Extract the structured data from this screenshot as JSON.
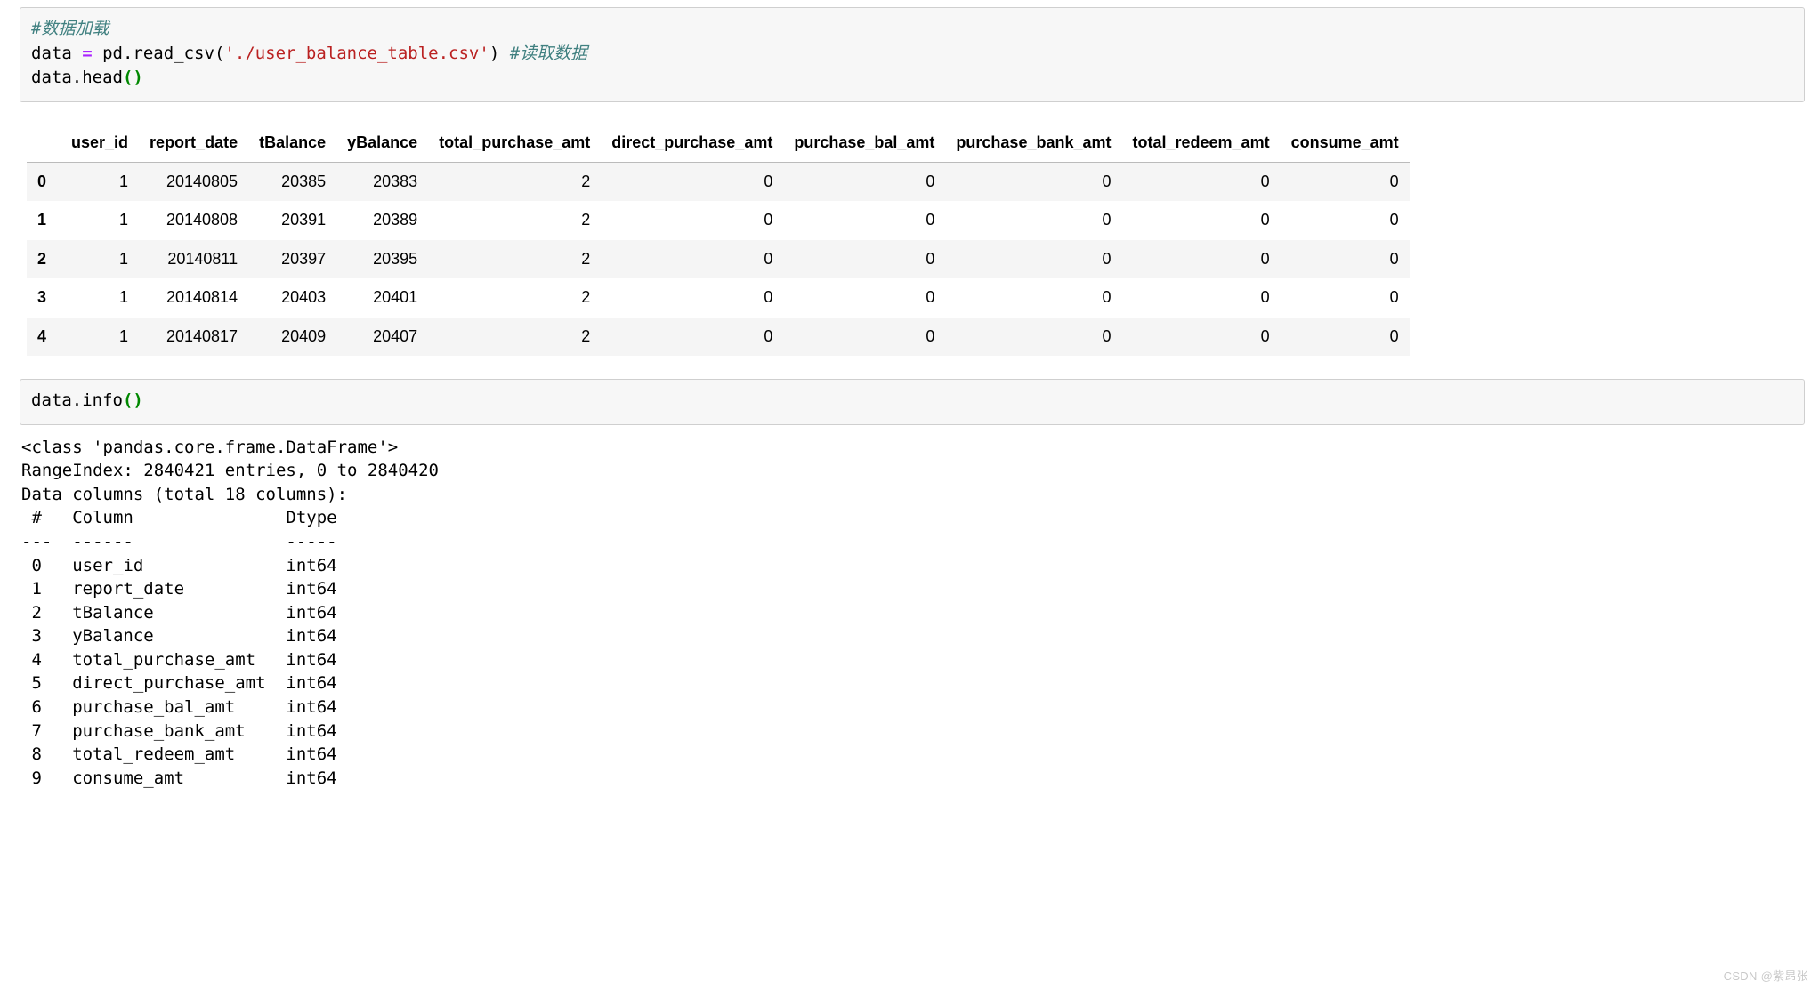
{
  "code_cell_1": {
    "line1_comment": "#数据加载",
    "line2_pre": "data ",
    "line2_op": "=",
    "line2_call": " pd.read_csv",
    "line2_str": "'./user_balance_table.csv'",
    "line2_comment": " #读取数据",
    "line3": "data.head"
  },
  "dataframe": {
    "columns": [
      "",
      "user_id",
      "report_date",
      "tBalance",
      "yBalance",
      "total_purchase_amt",
      "direct_purchase_amt",
      "purchase_bal_amt",
      "purchase_bank_amt",
      "total_redeem_amt",
      "consume_amt"
    ],
    "rows": [
      {
        "idx": "0",
        "vals": [
          "1",
          "20140805",
          "20385",
          "20383",
          "2",
          "0",
          "0",
          "0",
          "0",
          "0"
        ]
      },
      {
        "idx": "1",
        "vals": [
          "1",
          "20140808",
          "20391",
          "20389",
          "2",
          "0",
          "0",
          "0",
          "0",
          "0"
        ]
      },
      {
        "idx": "2",
        "vals": [
          "1",
          "20140811",
          "20397",
          "20395",
          "2",
          "0",
          "0",
          "0",
          "0",
          "0"
        ]
      },
      {
        "idx": "3",
        "vals": [
          "1",
          "20140814",
          "20403",
          "20401",
          "2",
          "0",
          "0",
          "0",
          "0",
          "0"
        ]
      },
      {
        "idx": "4",
        "vals": [
          "1",
          "20140817",
          "20409",
          "20407",
          "2",
          "0",
          "0",
          "0",
          "0",
          "0"
        ]
      }
    ]
  },
  "code_cell_2": {
    "line1": "data.info"
  },
  "info_output": {
    "lines": [
      "<class 'pandas.core.frame.DataFrame'>",
      "RangeIndex: 2840421 entries, 0 to 2840420",
      "Data columns (total 18 columns):",
      " #   Column               Dtype",
      "---  ------               -----",
      " 0   user_id              int64",
      " 1   report_date          int64",
      " 2   tBalance             int64",
      " 3   yBalance             int64",
      " 4   total_purchase_amt   int64",
      " 5   direct_purchase_amt  int64",
      " 6   purchase_bal_amt     int64",
      " 7   purchase_bank_amt    int64",
      " 8   total_redeem_amt     int64",
      " 9   consume_amt          int64"
    ]
  },
  "watermark": "CSDN @紫昂张"
}
